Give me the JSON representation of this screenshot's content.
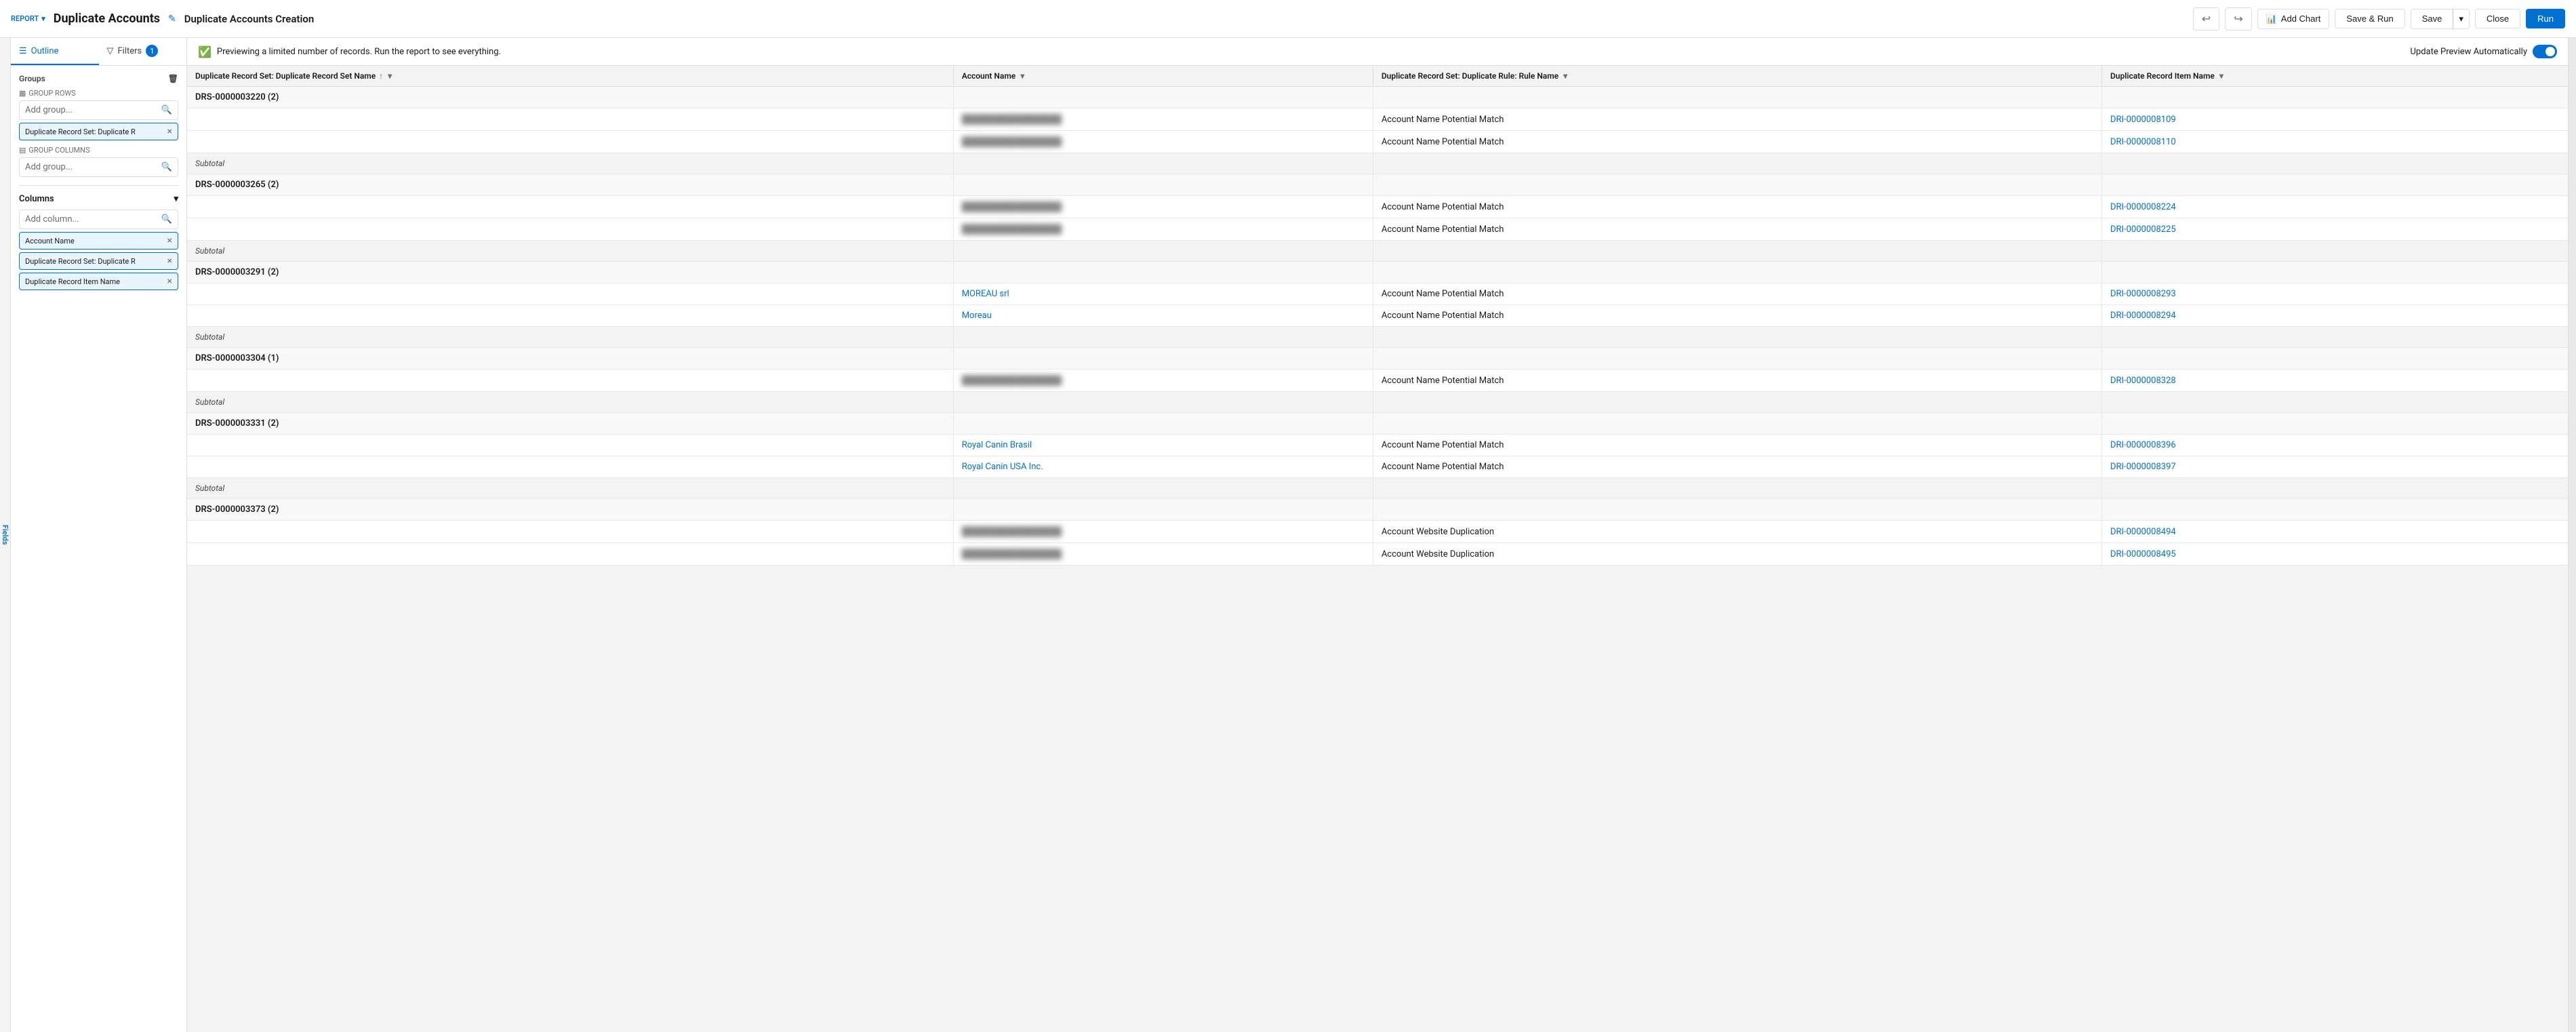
{
  "report": {
    "label": "REPORT",
    "title": "Duplicate Accounts",
    "subtitle": "Duplicate Accounts Creation"
  },
  "toolbar": {
    "undo_label": "",
    "redo_label": "",
    "add_chart_label": "Add Chart",
    "save_run_label": "Save & Run",
    "save_label": "Save",
    "close_label": "Close",
    "run_label": "Run"
  },
  "tabs": {
    "outline_label": "Outline",
    "filters_label": "Filters",
    "filter_count": "1"
  },
  "sidebar": {
    "fields_label": "Fields",
    "groups_label": "Groups",
    "group_rows_label": "GROUP ROWS",
    "add_group_placeholder": "Add group...",
    "group_columns_label": "GROUP COLUMNS",
    "delete_icon": "🗑",
    "group_tags": [
      {
        "label": "Duplicate Record Set: Duplicate R",
        "removable": true
      }
    ],
    "columns_label": "Columns",
    "add_column_placeholder": "Add column...",
    "column_tags": [
      {
        "label": "Account Name",
        "removable": true
      },
      {
        "label": "Duplicate Record Set: Duplicate R",
        "removable": true
      },
      {
        "label": "Duplicate Record Item Name",
        "removable": true
      }
    ]
  },
  "preview": {
    "message": "Previewing a limited number of records. Run the report to see everything.",
    "toggle_label": "Update Preview Automatically",
    "toggle_on": true
  },
  "table": {
    "columns": [
      {
        "label": "Duplicate Record Set: Duplicate Record Set Name",
        "sortable": true,
        "filterable": true
      },
      {
        "label": "Account Name",
        "filterable": true
      },
      {
        "label": "Duplicate Record Set: Duplicate Rule: Rule Name",
        "filterable": true
      },
      {
        "label": "Duplicate Record Item Name",
        "filterable": true
      }
    ],
    "rows": [
      {
        "type": "group",
        "group_id": "DRS-0000003220 (2)",
        "items": [
          {
            "account_name": "BLURRED_1",
            "blurred": true,
            "rule": "Account Name Potential Match",
            "dri": "DRI-0000008109"
          },
          {
            "account_name": "BLURRED_2",
            "blurred": true,
            "rule": "Account Name Potential Match",
            "dri": "DRI-0000008110"
          }
        ],
        "subtotal": "Subtotal"
      },
      {
        "type": "group",
        "group_id": "DRS-0000003265 (2)",
        "items": [
          {
            "account_name": "BLURRED_3",
            "blurred": true,
            "rule": "Account Name Potential Match",
            "dri": "DRI-0000008224"
          },
          {
            "account_name": "BLURRED_4",
            "blurred": true,
            "rule": "Account Name Potential Match",
            "dri": "DRI-0000008225"
          }
        ],
        "subtotal": "Subtotal"
      },
      {
        "type": "group",
        "group_id": "DRS-0000003291 (2)",
        "items": [
          {
            "account_name": "MOREAU srl",
            "blurred": false,
            "rule": "Account Name Potential Match",
            "dri": "DRI-0000008293"
          },
          {
            "account_name": "Moreau",
            "blurred": false,
            "rule": "Account Name Potential Match",
            "dri": "DRI-0000008294"
          }
        ],
        "subtotal": "Subtotal"
      },
      {
        "type": "group",
        "group_id": "DRS-0000003304 (1)",
        "items": [
          {
            "account_name": "BLURRED_5",
            "blurred": true,
            "rule": "Account Name Potential Match",
            "dri": "DRI-0000008328"
          }
        ],
        "subtotal": "Subtotal"
      },
      {
        "type": "group",
        "group_id": "DRS-0000003331 (2)",
        "items": [
          {
            "account_name": "Royal Canin Brasil",
            "blurred": false,
            "rule": "Account Name Potential Match",
            "dri": "DRI-0000008396"
          },
          {
            "account_name": "Royal Canin USA Inc.",
            "blurred": false,
            "rule": "Account Name Potential Match",
            "dri": "DRI-0000008397"
          }
        ],
        "subtotal": "Subtotal"
      },
      {
        "type": "group",
        "group_id": "DRS-0000003373 (2)",
        "items": [
          {
            "account_name": "BLURRED_6",
            "blurred": true,
            "rule": "Account Website Duplication",
            "dri": "DRI-0000008494"
          },
          {
            "account_name": "BLURRED_7",
            "blurred": true,
            "rule": "Account Website Duplication",
            "dri": "DRI-0000008495"
          }
        ],
        "subtotal": null
      }
    ]
  }
}
